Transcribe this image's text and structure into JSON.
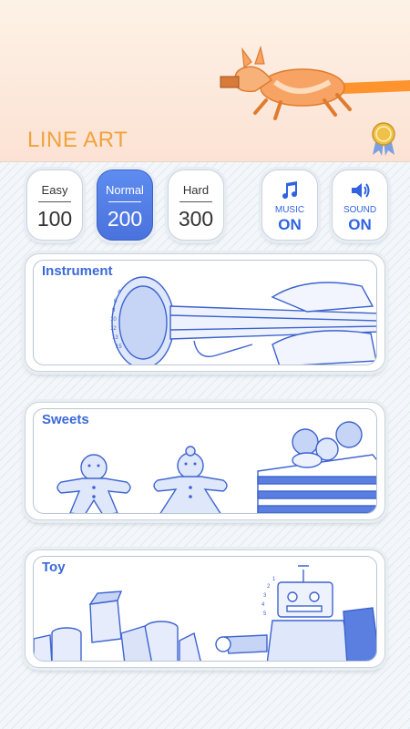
{
  "header": {
    "title": "LINE ART"
  },
  "difficulty": [
    {
      "label": "Easy",
      "value": "100",
      "selected": false
    },
    {
      "label": "Normal",
      "value": "200",
      "selected": true
    },
    {
      "label": "Hard",
      "value": "300",
      "selected": false
    }
  ],
  "music": {
    "icon": "music-note-icon",
    "label": "MUSIC",
    "state": "ON"
  },
  "sound": {
    "icon": "speaker-icon",
    "label": "SOUND",
    "state": "ON"
  },
  "categories": [
    {
      "title": "Instrument",
      "icon": "trumpet-sketch"
    },
    {
      "title": "Sweets",
      "icon": "gingerbread-cake-sketch"
    },
    {
      "title": "Toy",
      "icon": "blocks-robot-sketch"
    }
  ],
  "colors": {
    "accent": "#3a69d8",
    "title": "#f0a33c",
    "corgi": "#f08a3a"
  }
}
